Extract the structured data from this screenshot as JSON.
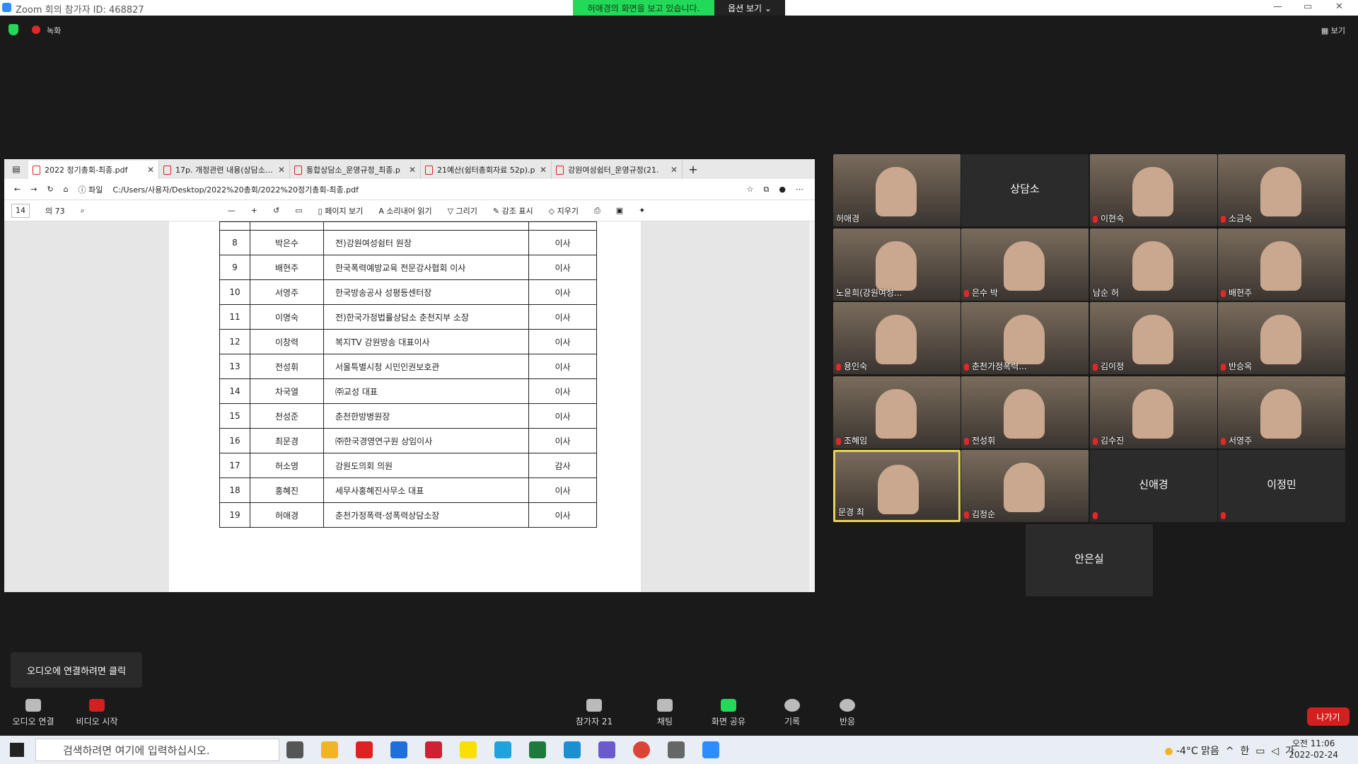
{
  "window": {
    "title": "Zoom 회의 참가자 ID: 468827"
  },
  "banner": {
    "message": "허애경의 화면을 보고 있습니다.",
    "options": "옵션 보기 ⌄"
  },
  "topbar": {
    "record_label": "녹화",
    "view_label": "보기"
  },
  "browser": {
    "tabs": [
      "2022 정기총회-최종.pdf",
      "17p. 개정관련 내용(상담소).p",
      "통합상담소_운영규정_최종.p",
      "21예산(쉼터총회자료 52p).p",
      "강원여성쉼터_운영규정(21."
    ],
    "address": {
      "prefix": "파일",
      "url": "C:/Users/사용자/Desktop/2022%20총회/2022%20정기총회-최종.pdf"
    },
    "pdf_toolbar": {
      "page": "14",
      "total": "의 73",
      "page_view": "페이지 보기",
      "read_aloud": "소리내어 읽기",
      "draw": "그리기",
      "highlight": "강조 표시",
      "erase": "지우기"
    },
    "table_rows": [
      [
        "8",
        "박은수",
        "전)강원여성쉼터 원장",
        "이사"
      ],
      [
        "9",
        "배현주",
        "한국폭력예방교육 전문강사협회 이사",
        "이사"
      ],
      [
        "10",
        "서영주",
        "한국방송공사 성평등센터장",
        "이사"
      ],
      [
        "11",
        "이명숙",
        "전)한국가정법률상담소 춘천지부 소장",
        "이사"
      ],
      [
        "12",
        "이창력",
        "복지TV 강원방송 대표이사",
        "이사"
      ],
      [
        "13",
        "전성휘",
        "서울특별시청 시민인권보호관",
        "이사"
      ],
      [
        "14",
        "차국열",
        "㈜교성 대표",
        "이사"
      ],
      [
        "15",
        "천성준",
        "춘천한방병원장",
        "이사"
      ],
      [
        "16",
        "최문경",
        "㈜한국경영연구원 상임이사",
        "이사"
      ],
      [
        "17",
        "허소영",
        "강원도의회 의원",
        "감사"
      ],
      [
        "18",
        "홍혜진",
        "세무사홍혜진사무소 대표",
        "이사"
      ],
      [
        "19",
        "허애경",
        "춘천가정폭력·성폭력상담소장",
        "이사"
      ]
    ]
  },
  "participants": [
    {
      "name": "허애경",
      "video": true,
      "muted": false
    },
    {
      "name": "상담소",
      "video": false,
      "muted": false
    },
    {
      "name": "이현숙",
      "video": true,
      "muted": true
    },
    {
      "name": "소금숙",
      "video": true,
      "muted": true
    },
    {
      "name": "노윤희(강원여성...",
      "video": true,
      "muted": false
    },
    {
      "name": "은수 박",
      "video": true,
      "muted": true
    },
    {
      "name": "남순 허",
      "video": true,
      "muted": false
    },
    {
      "name": "배현주",
      "video": true,
      "muted": true
    },
    {
      "name": "용인숙",
      "video": true,
      "muted": true
    },
    {
      "name": "춘천가정폭력...",
      "video": true,
      "muted": true
    },
    {
      "name": "김이정",
      "video": true,
      "muted": true
    },
    {
      "name": "반승옥",
      "video": true,
      "muted": true
    },
    {
      "name": "조혜임",
      "video": true,
      "muted": true
    },
    {
      "name": "전성휘",
      "video": true,
      "muted": true
    },
    {
      "name": "김수진",
      "video": true,
      "muted": true
    },
    {
      "name": "서영주",
      "video": true,
      "muted": true
    },
    {
      "name": "문경 최",
      "video": true,
      "muted": false,
      "speaker": true
    },
    {
      "name": "김정순",
      "video": true,
      "muted": true
    },
    {
      "name": "신애경",
      "video": false,
      "muted": true
    },
    {
      "name": "이정민",
      "video": false,
      "muted": true
    },
    {
      "name": "안은실",
      "video": false,
      "muted": false
    }
  ],
  "tooltip": "오디오에 연결하려면 클릭",
  "controls": {
    "audio": "오디오 연결",
    "video": "비디오 시작",
    "participants": "참가자",
    "participant_count": "21",
    "chat": "채팅",
    "share": "화면 공유",
    "record": "기록",
    "reactions": "반응",
    "leave": "나가기"
  },
  "taskbar": {
    "search_placeholder": "검색하려면 여기에 입력하십시오.",
    "weather": "-4°C 맑음",
    "ime": "가",
    "lang": "한",
    "time": "오전 11:06",
    "date": "2022-02-24"
  }
}
